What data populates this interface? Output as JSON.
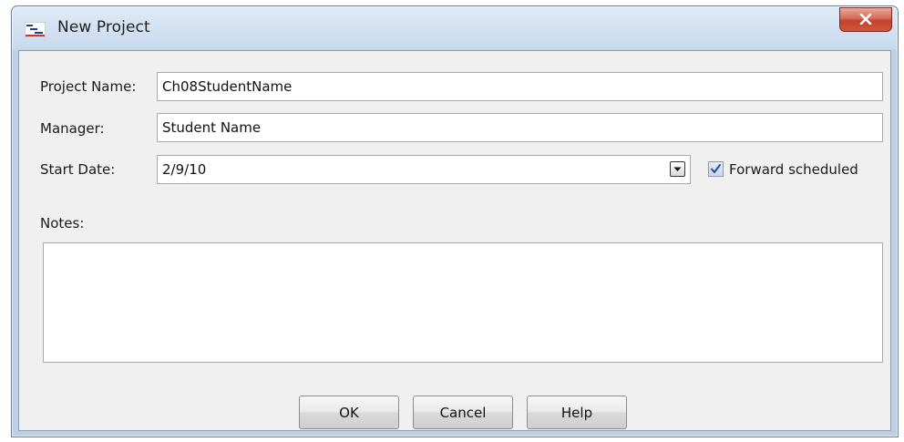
{
  "window": {
    "title": "New Project",
    "title_icon": "gantt-chart-icon",
    "close_icon": "close-icon"
  },
  "form": {
    "project_name": {
      "label": "Project Name:",
      "value": "Ch08StudentName"
    },
    "manager": {
      "label": "Manager:",
      "value": "Student Name"
    },
    "start_date": {
      "label": "Start Date:",
      "value": "2/9/10",
      "dropdown_icon": "chevron-down-icon"
    },
    "forward_scheduled": {
      "label": "Forward scheduled",
      "checked": true
    },
    "notes": {
      "label": "Notes:",
      "value": ""
    }
  },
  "buttons": {
    "ok": "OK",
    "cancel": "Cancel",
    "help": "Help"
  },
  "colors": {
    "close_button": "#c4412b",
    "title_bar": "#c9daee",
    "dialog_background": "#f0f0f0",
    "checkbox_check": "#1d4fa0"
  }
}
